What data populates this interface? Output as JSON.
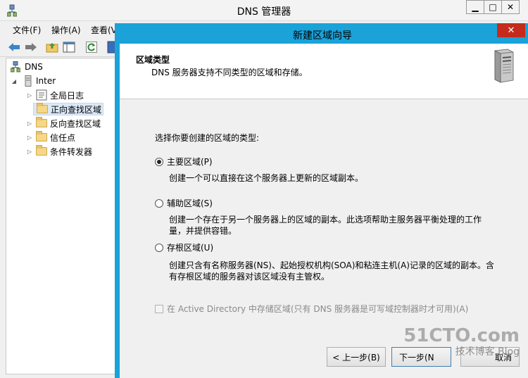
{
  "main_window": {
    "title": "DNS 管理器",
    "controls": [
      "▁",
      "□",
      "✕"
    ]
  },
  "menu": [
    "文件(F)",
    "操作(A)",
    "查看(V)"
  ],
  "tree": {
    "root": "DNS",
    "server": "Inter",
    "items": [
      "全局日志",
      "正向查找区域",
      "反向查找区域",
      "信任点",
      "条件转发器"
    ],
    "selected_index": 1
  },
  "wizard": {
    "title": "新建区域向导",
    "close_glyph": "✕",
    "header_title": "区域类型",
    "header_subtitle": "DNS 服务器支持不同类型的区域和存储。",
    "prompt": "选择你要创建的区域的类型:",
    "options": [
      {
        "label": "主要区域(P)",
        "description": "创建一个可以直接在这个服务器上更新的区域副本。",
        "checked": true
      },
      {
        "label": "辅助区域(S)",
        "description": "创建一个存在于另一个服务器上的区域的副本。此选项帮助主服务器平衡处理的工作量，并提供容错。",
        "checked": false
      },
      {
        "label": "存根区域(U)",
        "description": "创建只含有名称服务器(NS)、起始授权机构(SOA)和粘连主机(A)记录的区域的副本。含有存根区域的服务器对该区域没有主管权。",
        "checked": false
      }
    ],
    "ad_checkbox": {
      "label": "在 Active Directory 中存储区域(只有 DNS 服务器是可写域控制器时才可用)(A)",
      "checked": false,
      "disabled": true
    },
    "buttons": {
      "back": "< 上一步(B)",
      "next": "下一步(N",
      "cancel": "取消"
    }
  },
  "watermark": {
    "logo": "51CTO.com",
    "sub": "技术博客  Blog"
  }
}
